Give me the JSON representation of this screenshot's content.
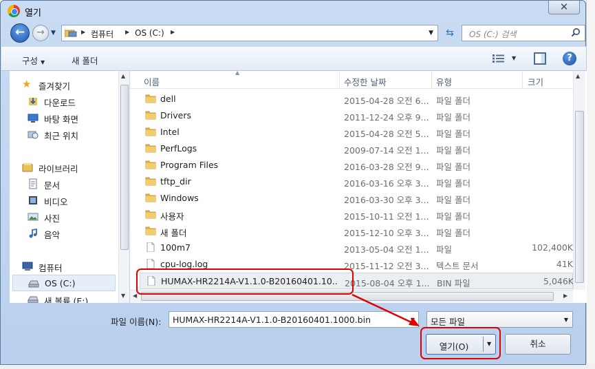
{
  "window": {
    "title": "열기",
    "close_glyph": "✕"
  },
  "address": {
    "segments": [
      "컴퓨터",
      "OS (C:)"
    ],
    "search_placeholder": "OS (C:) 검색"
  },
  "toolbar": {
    "organize_label": "구성",
    "new_folder_label": "새 폴더"
  },
  "nav": {
    "favorites": {
      "label": "즐겨찾기",
      "icon": "star-icon"
    },
    "favorite_items": [
      {
        "label": "다운로드",
        "icon": "downloads-icon"
      },
      {
        "label": "바탕 화면",
        "icon": "desktop-icon"
      },
      {
        "label": "최근 위치",
        "icon": "recent-places-icon"
      }
    ],
    "libraries": {
      "label": "라이브러리",
      "icon": "library-icon"
    },
    "library_items": [
      {
        "label": "문서",
        "icon": "documents-icon"
      },
      {
        "label": "비디오",
        "icon": "videos-icon"
      },
      {
        "label": "사진",
        "icon": "pictures-icon"
      },
      {
        "label": "음악",
        "icon": "music-icon"
      }
    ],
    "computer": {
      "label": "컴퓨터",
      "icon": "computer-icon"
    },
    "computer_items": [
      {
        "label": "OS (C:)",
        "icon": "drive-icon",
        "selected": true
      },
      {
        "label": "새 볼륨 (E:)",
        "icon": "drive-icon"
      }
    ]
  },
  "columns": {
    "name": "이름",
    "date": "수정한 날짜",
    "type": "유형",
    "size": "크기"
  },
  "files": [
    {
      "name": "dell",
      "date": "2015-04-28 오전 6...",
      "type": "파일 폴더",
      "size": "",
      "kind": "folder"
    },
    {
      "name": "Drivers",
      "date": "2011-12-24 오후 9...",
      "type": "파일 폴더",
      "size": "",
      "kind": "folder"
    },
    {
      "name": "Intel",
      "date": "2015-04-28 오전 5...",
      "type": "파일 폴더",
      "size": "",
      "kind": "folder"
    },
    {
      "name": "PerfLogs",
      "date": "2009-07-14 오전 1...",
      "type": "파일 폴더",
      "size": "",
      "kind": "folder"
    },
    {
      "name": "Program Files",
      "date": "2016-03-28 오전 9...",
      "type": "파일 폴더",
      "size": "",
      "kind": "folder"
    },
    {
      "name": "tftp_dir",
      "date": "2016-03-16 오후 3...",
      "type": "파일 폴더",
      "size": "",
      "kind": "folder"
    },
    {
      "name": "Windows",
      "date": "2016-03-30 오후 3...",
      "type": "파일 폴더",
      "size": "",
      "kind": "folder"
    },
    {
      "name": "사용자",
      "date": "2015-10-11 오전 1...",
      "type": "파일 폴더",
      "size": "",
      "kind": "folder"
    },
    {
      "name": "새 폴더",
      "date": "2015-12-10 오후 3...",
      "type": "파일 폴더",
      "size": "",
      "kind": "folder"
    },
    {
      "name": "100m7",
      "date": "2013-05-04 오전 1...",
      "type": "파일",
      "size": "102,400K",
      "kind": "file"
    },
    {
      "name": "cpu-log.log",
      "date": "2015-11-12 오전 3...",
      "type": "텍스트 문서",
      "size": "41K",
      "kind": "file"
    },
    {
      "name": "HUMAX-HR2214A-V1.1.0-B20160401.10...",
      "date": "2015-08-04 오후 1...",
      "type": "BIN 파일",
      "size": "5,046K",
      "kind": "file",
      "selected": true
    }
  ],
  "bottom": {
    "filename_label": "파일 이름(N):",
    "filename_value": "HUMAX-HR2214A-V1.1.0-B20160401.1000.bin",
    "filetype_value": "모든 파일",
    "open_label": "열기(O)",
    "cancel_label": "취소"
  },
  "colors": {
    "annotation": "#e00000",
    "folder": "#e8b84a"
  }
}
